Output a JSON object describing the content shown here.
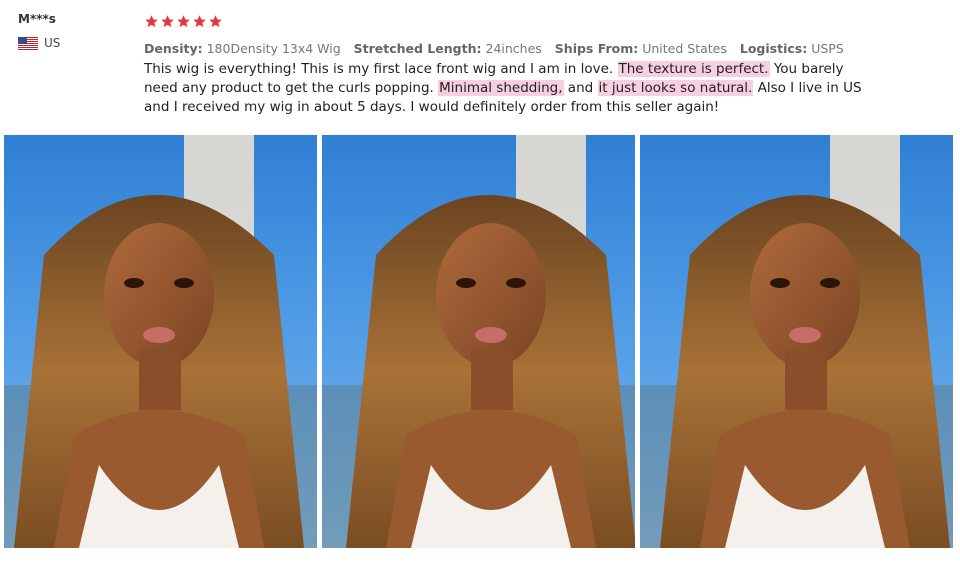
{
  "reviewer": {
    "name": "M***s",
    "country": "US",
    "flag_icon": "us-flag-icon"
  },
  "rating": {
    "stars": 5,
    "star_color": "#e4393c"
  },
  "specs": [
    {
      "label": "Density:",
      "value": "180Density 13x4 Wig"
    },
    {
      "label": "Stretched Length:",
      "value": "24inches"
    },
    {
      "label": "Ships From:",
      "value": "United States"
    },
    {
      "label": "Logistics:",
      "value": "USPS"
    }
  ],
  "review": {
    "segments": [
      {
        "text": "This wig is everything! This is my first lace front wig and I am in love. ",
        "highlight": false
      },
      {
        "text": "The texture is perfect.",
        "highlight": true
      },
      {
        "text": " You barely need any product to get the curls popping. ",
        "highlight": false
      },
      {
        "text": "Minimal shedding,",
        "highlight": true
      },
      {
        "text": " and ",
        "highlight": false
      },
      {
        "text": "it just looks so natural.",
        "highlight": true
      },
      {
        "text": " Also I live in US and I received my wig in about 5 days. I would definitely order from this seller again!",
        "highlight": false
      }
    ],
    "highlight_color": "#f8cfe0"
  },
  "photos": [
    {
      "name": "review-photo-1"
    },
    {
      "name": "review-photo-2"
    },
    {
      "name": "review-photo-3"
    }
  ]
}
